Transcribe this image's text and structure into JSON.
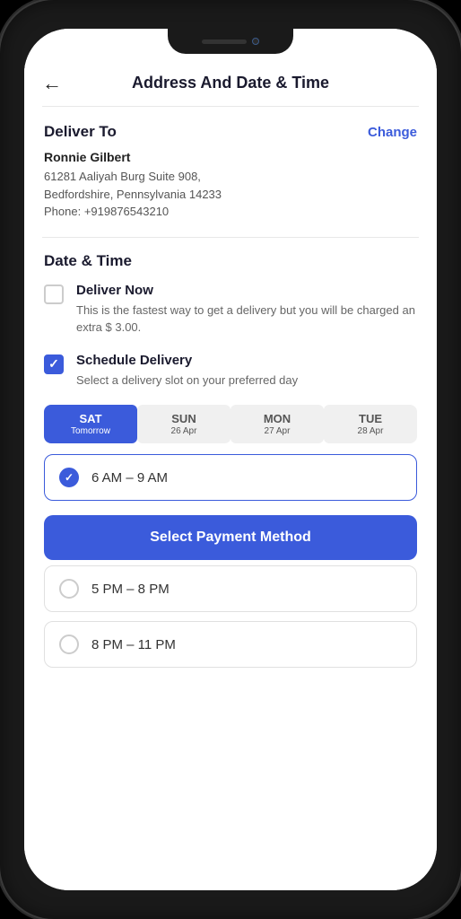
{
  "header": {
    "back_label": "←",
    "title": "Address And Date & Time"
  },
  "deliver_to": {
    "section_label": "Deliver To",
    "change_label": "Change",
    "name": "Ronnie Gilbert",
    "address_line1": "61281 Aaliyah Burg Suite 908,",
    "address_line2": "Bedfordshire, Pennsylvania 14233",
    "phone": "Phone: +919876543210"
  },
  "date_time": {
    "section_label": "Date & Time",
    "deliver_now": {
      "label": "Deliver Now",
      "checked": false,
      "description": "This is the fastest way to get a delivery but you will be charged an extra $ 3.00."
    },
    "schedule_delivery": {
      "label": "Schedule Delivery",
      "checked": true,
      "description": "Select a delivery slot on your preferred day"
    }
  },
  "day_tabs": [
    {
      "name": "SAT",
      "sub": "Tomorrow",
      "active": true
    },
    {
      "name": "SUN",
      "sub": "26 Apr",
      "active": false
    },
    {
      "name": "MON",
      "sub": "27 Apr",
      "active": false
    },
    {
      "name": "TUE",
      "sub": "28 Apr",
      "active": false
    }
  ],
  "time_slots": [
    {
      "label": "6 AM – 9 AM",
      "selected": true
    },
    {
      "label": "5 PM – 8 PM",
      "selected": false
    },
    {
      "label": "8 PM – 11 PM",
      "selected": false
    }
  ],
  "select_payment_btn": "Select Payment Method"
}
